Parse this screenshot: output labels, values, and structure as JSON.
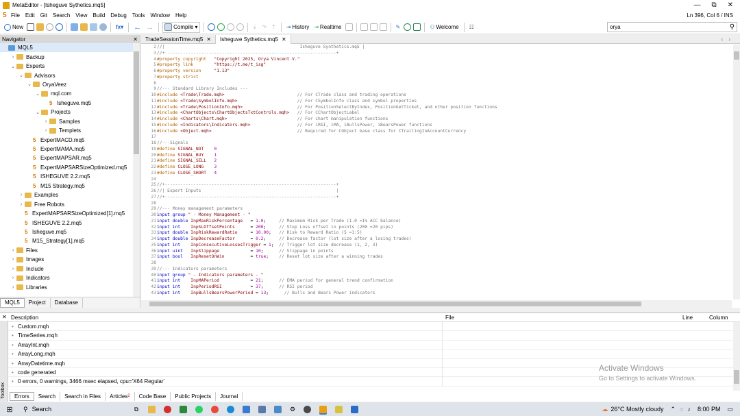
{
  "app": {
    "title": "MetaEditor - [Isheguve Sythetics.mq5]",
    "caret_status": "Ln 396, Col 6 / INS",
    "window_controls": [
      "—",
      "⧉",
      "✕"
    ]
  },
  "menu": [
    "File",
    "Edit",
    "Git",
    "Search",
    "View",
    "Build",
    "Debug",
    "Tools",
    "Window",
    "Help"
  ],
  "toolbar": {
    "new": "New",
    "compile": "Compile",
    "history": "History",
    "realtime": "Realtime",
    "welcome": "Welcome",
    "search_value": "orya"
  },
  "navigator": {
    "title": "Navigator",
    "items": [
      {
        "label": "MQL5",
        "depth": 0,
        "kind": "root",
        "tog": ""
      },
      {
        "label": "Backup",
        "depth": 1,
        "kind": "folder",
        "tog": "›"
      },
      {
        "label": "Experts",
        "depth": 1,
        "kind": "folder",
        "tog": "⌄"
      },
      {
        "label": "Advisors",
        "depth": 2,
        "kind": "folder",
        "tog": "⌄"
      },
      {
        "label": "OryaVeez",
        "depth": 3,
        "kind": "folder",
        "tog": "⌄"
      },
      {
        "label": "mql.com",
        "depth": 4,
        "kind": "folder",
        "tog": "⌄"
      },
      {
        "label": "Isheguve.mq5",
        "depth": 5,
        "kind": "file",
        "tog": ""
      },
      {
        "label": "Projects",
        "depth": 4,
        "kind": "folder",
        "tog": "⌄"
      },
      {
        "label": "Samples",
        "depth": 5,
        "kind": "folder",
        "tog": "›"
      },
      {
        "label": "Templets",
        "depth": 5,
        "kind": "folder",
        "tog": "›"
      },
      {
        "label": "ExpertMACD.mq5",
        "depth": 3,
        "kind": "file",
        "tog": ""
      },
      {
        "label": "ExpertMAMA.mq5",
        "depth": 3,
        "kind": "file",
        "tog": ""
      },
      {
        "label": "ExpertMAPSAR.mq5",
        "depth": 3,
        "kind": "file",
        "tog": ""
      },
      {
        "label": "ExpertMAPSARSizeOptimized.mq5",
        "depth": 3,
        "kind": "file",
        "tog": ""
      },
      {
        "label": "ISHEGUVE 2.2.mq5",
        "depth": 3,
        "kind": "file",
        "tog": ""
      },
      {
        "label": "M15 Strategy.mq5",
        "depth": 3,
        "kind": "file",
        "tog": ""
      },
      {
        "label": "Examples",
        "depth": 2,
        "kind": "folder",
        "tog": "›"
      },
      {
        "label": "Free Robots",
        "depth": 2,
        "kind": "folder",
        "tog": "›"
      },
      {
        "label": "ExpertMAPSARSizeOptimized[1].mq5",
        "depth": 2,
        "kind": "file",
        "tog": ""
      },
      {
        "label": "ISHEGUVE 2.2.mq5",
        "depth": 2,
        "kind": "file",
        "tog": ""
      },
      {
        "label": "Isheguve.mq5",
        "depth": 2,
        "kind": "file",
        "tog": ""
      },
      {
        "label": "M15_Strategy[1].mq5",
        "depth": 2,
        "kind": "file",
        "tog": ""
      },
      {
        "label": "Files",
        "depth": 1,
        "kind": "folder",
        "tog": "›"
      },
      {
        "label": "Images",
        "depth": 1,
        "kind": "folder",
        "tog": "›"
      },
      {
        "label": "Include",
        "depth": 1,
        "kind": "folder",
        "tog": "›"
      },
      {
        "label": "Indicators",
        "depth": 1,
        "kind": "folder",
        "tog": "›"
      },
      {
        "label": "Libraries",
        "depth": 1,
        "kind": "folder",
        "tog": "›"
      }
    ],
    "tabs": [
      "MQL5",
      "Project",
      "Database"
    ]
  },
  "editor": {
    "tabs": [
      {
        "label": "TradeSessionTime.mq5",
        "active": false
      },
      {
        "label": "Isheguve Sythetics.mq5",
        "active": true
      }
    ],
    "lines": [
      {
        "n": "2",
        "parts": [
          [
            "cm",
            "//|                                                    Isheguve Synthetics.mq5 |"
          ]
        ]
      },
      {
        "n": "3",
        "parts": [
          [
            "cm",
            "//+------------------------------------------------------------------+"
          ]
        ]
      },
      {
        "n": "4",
        "parts": [
          [
            "mc",
            "#property copyright"
          ],
          [
            "st",
            "   \"Copyright 2025, Orya Vincent V.\""
          ]
        ]
      },
      {
        "n": "5",
        "parts": [
          [
            "mc",
            "#property link"
          ],
          [
            "st",
            "        \"https://t.me/t_isg\""
          ]
        ]
      },
      {
        "n": "6",
        "parts": [
          [
            "mc",
            "#property version"
          ],
          [
            "st",
            "     \"1.13\""
          ]
        ]
      },
      {
        "n": "7",
        "parts": [
          [
            "mc",
            "#property strict"
          ]
        ]
      },
      {
        "n": "8",
        "parts": []
      },
      {
        "n": "9",
        "parts": [
          [
            "cm",
            "//--- Standard Library Includes ---"
          ]
        ]
      },
      {
        "n": "10",
        "parts": [
          [
            "mc",
            "#include"
          ],
          [
            "st",
            " <Trade\\Trade.mqh>"
          ],
          [
            "cm",
            "                            // For CTrade class and trading operations"
          ]
        ]
      },
      {
        "n": "11",
        "parts": [
          [
            "mc",
            "#include"
          ],
          [
            "st",
            " <Trade\\SymbolInfo.mqh>"
          ],
          [
            "cm",
            "                       // For CSymbolInfo class and symbol properties"
          ]
        ]
      },
      {
        "n": "12",
        "parts": [
          [
            "mc",
            "#include"
          ],
          [
            "st",
            " <Trade\\PositionInfo.mqh>"
          ],
          [
            "cm",
            "                     // For PositionSelectByIndex, PositionGetTicket, and other position functions"
          ]
        ]
      },
      {
        "n": "13",
        "parts": [
          [
            "mc",
            "#include"
          ],
          [
            "st",
            " <ChartObjects\\ChartObjectsTxtControls.mqh>"
          ],
          [
            "cm",
            "   // For CChartObjectLabel"
          ]
        ]
      },
      {
        "n": "14",
        "parts": [
          [
            "mc",
            "#include"
          ],
          [
            "st",
            " <Charts\\Chart.mqh>"
          ],
          [
            "cm",
            "                           // For chart manipulation functions"
          ]
        ]
      },
      {
        "n": "15",
        "parts": [
          [
            "mc",
            "#include"
          ],
          [
            "st",
            " <Indicators\\Indicators.mqh>"
          ],
          [
            "cm",
            "                  // For iRSI, iMA, iBullsPower, iBearsPower functions"
          ]
        ]
      },
      {
        "n": "16",
        "parts": [
          [
            "mc",
            "#include"
          ],
          [
            "st",
            " <Object.mqh>"
          ],
          [
            "cm",
            "                                 // Required for CObject base class for CTrailingInAccountCurrency"
          ]
        ]
      },
      {
        "n": "17",
        "parts": []
      },
      {
        "n": "18",
        "parts": [
          [
            "cm",
            "//---Signals"
          ]
        ]
      },
      {
        "n": "19",
        "parts": [
          [
            "mc",
            "#define"
          ],
          [
            "vr",
            " SIGNAL_NOT"
          ],
          [
            "nm",
            "    0"
          ]
        ]
      },
      {
        "n": "20",
        "parts": [
          [
            "mc",
            "#define"
          ],
          [
            "vr",
            " SIGNAL_BUY"
          ],
          [
            "nm",
            "    1"
          ]
        ]
      },
      {
        "n": "21",
        "parts": [
          [
            "mc",
            "#define"
          ],
          [
            "vr",
            " SIGNAL_SELL"
          ],
          [
            "nm",
            "   2"
          ]
        ]
      },
      {
        "n": "22",
        "parts": [
          [
            "mc",
            "#define"
          ],
          [
            "vr",
            " CLOSE_LONG"
          ],
          [
            "nm",
            "    3"
          ]
        ]
      },
      {
        "n": "23",
        "parts": [
          [
            "mc",
            "#define"
          ],
          [
            "vr",
            " CLOSE_SHORT"
          ],
          [
            "nm",
            "   4"
          ]
        ]
      },
      {
        "n": "24",
        "parts": []
      },
      {
        "n": "25",
        "parts": [
          [
            "cm",
            "//+------------------------------------------------------------------+"
          ]
        ]
      },
      {
        "n": "26",
        "parts": [
          [
            "cm",
            "//| Expert Inputs                                                    |"
          ]
        ]
      },
      {
        "n": "27",
        "parts": [
          [
            "cm",
            "//+------------------------------------------------------------------+"
          ]
        ]
      },
      {
        "n": "28",
        "parts": []
      },
      {
        "n": "29",
        "parts": [
          [
            "cm",
            "//--- Money management parameters"
          ]
        ]
      },
      {
        "n": "30",
        "parts": [
          [
            "kw",
            "input group"
          ],
          [
            "st",
            " \" - Money Management - \""
          ]
        ]
      },
      {
        "n": "31",
        "parts": [
          [
            "kw",
            "input double"
          ],
          [
            "vr",
            " InpMaxRiskPercentage"
          ],
          [
            "",
            "   = "
          ],
          [
            "nm",
            "1.0"
          ],
          [
            "",
            ";"
          ],
          [
            "cm",
            "     // Maximum Risk per Trade (1.0 =1% ACC balance)"
          ]
        ]
      },
      {
        "n": "32",
        "parts": [
          [
            "kw",
            "input int   "
          ],
          [
            "vr",
            " InpSLOffsetPoints"
          ],
          [
            "",
            "      = "
          ],
          [
            "nm",
            "200"
          ],
          [
            "",
            ";"
          ],
          [
            "cm",
            "     // Stop Loss offset in points (200 =20 pips)"
          ]
        ]
      },
      {
        "n": "33",
        "parts": [
          [
            "kw",
            "input double"
          ],
          [
            "vr",
            " InpRiskRewardRatio"
          ],
          [
            "",
            "     = "
          ],
          [
            "nm",
            "10.00"
          ],
          [
            "",
            ";"
          ],
          [
            "cm",
            "   // Risk to Reward Ratio (5 =1:5)"
          ]
        ]
      },
      {
        "n": "34",
        "parts": [
          [
            "kw",
            "input double"
          ],
          [
            "vr",
            " InpDecreaseFactor"
          ],
          [
            "",
            "      = "
          ],
          [
            "nm",
            "0.2"
          ],
          [
            "",
            ";"
          ],
          [
            "cm",
            "     // Decrease factor (lot size after a losing trades)"
          ]
        ]
      },
      {
        "n": "35",
        "parts": [
          [
            "kw",
            "input int   "
          ],
          [
            "vr",
            " InpConsecutiveLossesTrigger"
          ],
          [
            "",
            " = "
          ],
          [
            "nm",
            "1"
          ],
          [
            "",
            ";"
          ],
          [
            "cm",
            "  // Trigger lot size decrease (1, 2, 3)"
          ]
        ]
      },
      {
        "n": "36",
        "parts": [
          [
            "kw",
            "input uint  "
          ],
          [
            "vr",
            " InpSlippage"
          ],
          [
            "",
            "            = "
          ],
          [
            "nm",
            "10"
          ],
          [
            "",
            ";"
          ],
          [
            "cm",
            "      // Slippage in points"
          ]
        ]
      },
      {
        "n": "37",
        "parts": [
          [
            "kw",
            "input bool  "
          ],
          [
            "vr",
            " InpResetOnWin"
          ],
          [
            "",
            "          = "
          ],
          [
            "nm",
            "true"
          ],
          [
            "",
            ";"
          ],
          [
            "cm",
            "    // Reset lot size after a winning trades"
          ]
        ]
      },
      {
        "n": "38",
        "parts": []
      },
      {
        "n": "39",
        "parts": [
          [
            "cm",
            "//--- Indicators parameters"
          ]
        ]
      },
      {
        "n": "40",
        "parts": [
          [
            "kw",
            "input group"
          ],
          [
            "st",
            " \" - Indicators parameters - \""
          ]
        ]
      },
      {
        "n": "41",
        "parts": [
          [
            "kw",
            "input int   "
          ],
          [
            "vr",
            " InpMAPeriod"
          ],
          [
            "",
            "            = "
          ],
          [
            "nm",
            "21"
          ],
          [
            "",
            ";"
          ],
          [
            "cm",
            "      // EMA period for general trend confirmation"
          ]
        ]
      },
      {
        "n": "42",
        "parts": [
          [
            "kw",
            "input int   "
          ],
          [
            "vr",
            " InpPeriodRSI"
          ],
          [
            "",
            "           = "
          ],
          [
            "nm",
            "37"
          ],
          [
            "",
            ";"
          ],
          [
            "cm",
            "      // RSI period"
          ]
        ]
      },
      {
        "n": "43",
        "parts": [
          [
            "kw",
            "input int   "
          ],
          [
            "vr",
            " InpBullsBearsPowerPeriod"
          ],
          [
            "",
            " = "
          ],
          [
            "nm",
            "13"
          ],
          [
            "",
            ";"
          ],
          [
            "cm",
            "      // Bulls and Bears Power indicators"
          ]
        ]
      }
    ]
  },
  "output": {
    "columns": {
      "description": "Description",
      "file": "File",
      "line": "Line",
      "column": "Column"
    },
    "rows": [
      "Custom.mqh",
      "TimeSeries.mqh",
      "ArrayInt.mqh",
      "ArrayLong.mqh",
      "ArrayDatetime.mqh",
      "code generated",
      "0 errors, 0 warnings, 3466 msec elapsed, cpu='X64 Regular'"
    ],
    "tabs": [
      "Errors",
      "Search",
      "Search in Files",
      "Articles",
      "Code Base",
      "Public Projects",
      "Journal"
    ],
    "articles_badge": "2",
    "toolbox_label": "Toolbox"
  },
  "watermark": {
    "title": "Activate Windows",
    "subtitle": "Go to Settings to activate Windows."
  },
  "taskbar": {
    "search": "Search",
    "weather": "26°C  Mostly cloudy",
    "time": "8:00 PM"
  }
}
